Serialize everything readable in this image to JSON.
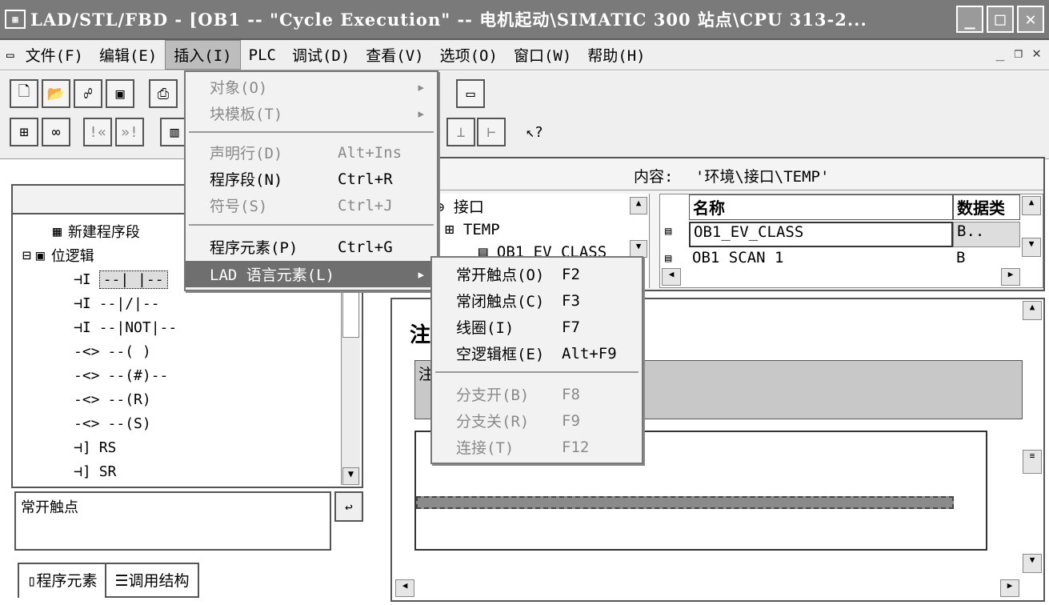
{
  "window": {
    "title": "LAD/STL/FBD  - [OB1 -- \"Cycle Execution\" -- 电机起动\\SIMATIC 300 站点\\CPU 313-2..."
  },
  "menubar": {
    "items": [
      "文件(F)",
      "编辑(E)",
      "插入(I)",
      "PLC",
      "调试(D)",
      "查看(V)",
      "选项(O)",
      "窗口(W)",
      "帮助(H)"
    ]
  },
  "insert_menu": {
    "items": [
      {
        "label": "对象(O)",
        "shortcut": "",
        "arrow": "▸"
      },
      {
        "label": "块模板(T)",
        "shortcut": "",
        "arrow": "▸"
      },
      {
        "label": "声明行(D)",
        "shortcut": "Alt+Ins"
      },
      {
        "label": "程序段(N)",
        "shortcut": "Ctrl+R"
      },
      {
        "label": "符号(S)",
        "shortcut": "Ctrl+J"
      },
      {
        "label": "程序元素(P)",
        "shortcut": "Ctrl+G"
      },
      {
        "label": "LAD 语言元素(L)",
        "shortcut": "",
        "arrow": "▸"
      }
    ]
  },
  "lad_submenu": {
    "items": [
      {
        "label": "常开触点(O)",
        "shortcut": "F2"
      },
      {
        "label": "常闭触点(C)",
        "shortcut": "F3"
      },
      {
        "label": "线圈(I)",
        "shortcut": "F7"
      },
      {
        "label": "空逻辑框(E)",
        "shortcut": "Alt+F9"
      },
      {
        "label": "分支开(B)",
        "shortcut": "F8"
      },
      {
        "label": "分支关(R)",
        "shortcut": "F9"
      },
      {
        "label": "连接(T)",
        "shortcut": "F12"
      }
    ]
  },
  "program_elements": {
    "new_network": "新建程序段",
    "bit_logic": "位逻辑",
    "items": [
      "--| |--",
      "--|/|--",
      "--|NOT|--",
      "--( )",
      "--(#)--",
      "--(R)",
      "--(S)",
      "RS",
      "SR"
    ],
    "description": "常开触点",
    "tabs": [
      "程序元素",
      "调用结构"
    ]
  },
  "interface": {
    "content_label": "内容:",
    "content_path": "'环境\\接口\\TEMP'",
    "tree_root": "接口",
    "tree_temp": "TEMP",
    "tree_child": "OB1_EV_CLASS",
    "col_name": "名称",
    "col_type": "数据类",
    "rows": [
      {
        "name": "OB1_EV_CLASS",
        "type": "B.."
      },
      {
        "name": "OB1_SCAN_1",
        "type": "B"
      }
    ]
  },
  "editor": {
    "network_title_partial": "注",
    "comment_partial": "注"
  }
}
